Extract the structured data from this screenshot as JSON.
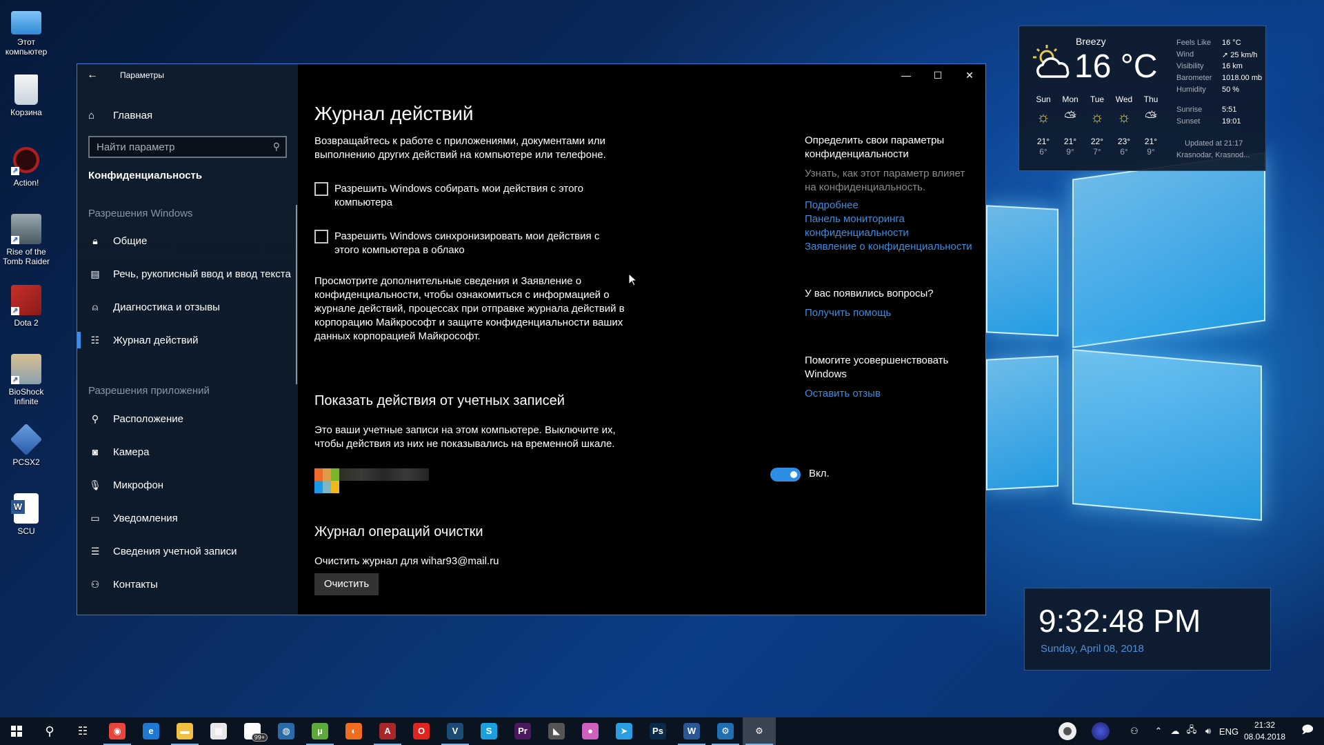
{
  "desktop": {
    "icons": [
      {
        "label": "Этот компьютер",
        "icon": "computer-icon"
      },
      {
        "label": "Корзина",
        "icon": "recycle-bin-icon"
      },
      {
        "label": "Action!",
        "icon": "action-app-icon"
      },
      {
        "label": "Rise of the Tomb Raider",
        "icon": "tomb-raider-icon"
      },
      {
        "label": "Dota 2",
        "icon": "dota2-icon"
      },
      {
        "label": "BioShock Infinite",
        "icon": "bioshock-icon"
      },
      {
        "label": "PCSX2",
        "icon": "pcsx2-icon"
      },
      {
        "label": "SCU",
        "icon": "word-document-icon"
      }
    ]
  },
  "window": {
    "title": "Параметры",
    "controls": {
      "minimize": "—",
      "maximize": "☐",
      "close": "✕"
    }
  },
  "sidebar": {
    "home_label": "Главная",
    "search_placeholder": "Найти параметр",
    "section_title": "Конфиденциальность",
    "category_windows": "Разрешения Windows",
    "category_apps": "Разрешения приложений",
    "windows_items": [
      {
        "label": "Общие",
        "icon": "lock-icon"
      },
      {
        "label": "Речь, рукописный ввод и ввод текста",
        "icon": "clipboard-icon"
      },
      {
        "label": "Диагностика и отзывы",
        "icon": "feedback-icon"
      },
      {
        "label": "Журнал действий",
        "icon": "timeline-icon",
        "active": true
      }
    ],
    "app_items": [
      {
        "label": "Расположение",
        "icon": "location-icon"
      },
      {
        "label": "Камера",
        "icon": "camera-icon"
      },
      {
        "label": "Микрофон",
        "icon": "microphone-icon"
      },
      {
        "label": "Уведомления",
        "icon": "notification-icon"
      },
      {
        "label": "Сведения учетной записи",
        "icon": "account-info-icon"
      },
      {
        "label": "Контакты",
        "icon": "contacts-icon"
      }
    ]
  },
  "main": {
    "title": "Журнал действий",
    "intro": "Возвращайтесь к работе с приложениями, документами или выполнению других действий на компьютере или телефоне.",
    "checkboxes": [
      {
        "label": "Разрешить Windows собирать мои действия с этого компьютера",
        "checked": false
      },
      {
        "label": "Разрешить Windows синхронизировать мои действия с этого компьютера в облако",
        "checked": false
      }
    ],
    "privacy_text": "Просмотрите дополнительные сведения и Заявление о конфиденциальности, чтобы ознакомиться с информацией о журнале действий, процессах при отправке журнала действий в корпорацию Майкрософт и защите конфиденциальности ваших данных корпорацией Майкрософт.",
    "accounts_heading": "Показать действия от учетных записей",
    "accounts_text": "Это ваши учетные записи на этом компьютере. Выключите их, чтобы действия из них не показывались на временной шкале.",
    "account_toggle": {
      "state": "on",
      "label": "Вкл."
    },
    "clear_heading": "Журнал операций очистки",
    "clear_text": "Очистить журнал для wihar93@mail.ru",
    "clear_button": "Очистить"
  },
  "aside": {
    "privacy_heading": "Определить свои параметры конфиденциальности",
    "privacy_sub": "Узнать, как этот параметр влияет на конфиденциальность.",
    "links": [
      "Подробнее",
      "Панель мониторинга конфиденциальности",
      "Заявление о конфиденциальности"
    ],
    "questions_heading": "У вас появились вопросы?",
    "help_link": "Получить помощь",
    "improve_heading": "Помогите усовершенствовать Windows",
    "feedback_link": "Оставить отзыв"
  },
  "weather": {
    "condition": "Breezy",
    "temperature": "16 °C",
    "details": [
      {
        "label": "Feels Like",
        "value": "16 °C"
      },
      {
        "label": "Wind",
        "value": "➚ 25 km/h"
      },
      {
        "label": "Visibility",
        "value": "16 km"
      },
      {
        "label": "Barometer",
        "value": "1018.00 mb"
      },
      {
        "label": "Humidity",
        "value": "50 %"
      }
    ],
    "sunrise_label": "Sunrise",
    "sunrise": "5:51",
    "sunset_label": "Sunset",
    "sunset": "19:01",
    "updated": "Updated at 21:17",
    "location": "Krasnodar, Krasnod...",
    "forecast": [
      {
        "day": "Sun",
        "icon": "sunny",
        "hi": "21°",
        "lo": "6°"
      },
      {
        "day": "Mon",
        "icon": "partly-cloudy",
        "hi": "21°",
        "lo": "9°"
      },
      {
        "day": "Tue",
        "icon": "sunny",
        "hi": "22°",
        "lo": "7°"
      },
      {
        "day": "Wed",
        "icon": "sunny",
        "hi": "23°",
        "lo": "6°"
      },
      {
        "day": "Thu",
        "icon": "partly-cloudy",
        "hi": "21°",
        "lo": "9°"
      }
    ]
  },
  "clock_widget": {
    "time": "9:32:48 PM",
    "date": "Sunday, April 08, 2018"
  },
  "taskbar": {
    "apps": [
      {
        "name": "chrome",
        "glyph": "◉",
        "color": "#e8453c",
        "open": true
      },
      {
        "name": "edge",
        "glyph": "e",
        "color": "#1f78d1",
        "open": false
      },
      {
        "name": "file-explorer",
        "glyph": "▬",
        "color": "#f0c040",
        "open": true
      },
      {
        "name": "store",
        "glyph": "▦",
        "color": "#e8e8e8",
        "open": false
      },
      {
        "name": "mail",
        "glyph": "✉",
        "color": "#ffffff",
        "open": false,
        "badge": "99+"
      },
      {
        "name": "steam",
        "glyph": "◍",
        "color": "#2a6aa8",
        "open": false
      },
      {
        "name": "utorrent",
        "glyph": "µ",
        "color": "#5da83a",
        "open": true
      },
      {
        "name": "origin",
        "glyph": "◐",
        "color": "#f06c1f",
        "open": false
      },
      {
        "name": "action",
        "glyph": "A",
        "color": "#a8282a",
        "open": true
      },
      {
        "name": "opera",
        "glyph": "O",
        "color": "#e0241f",
        "open": false
      },
      {
        "name": "vegas",
        "glyph": "V",
        "color": "#1a4c74",
        "open": true
      },
      {
        "name": "skype",
        "glyph": "S",
        "color": "#1aa0e0",
        "open": false
      },
      {
        "name": "premiere",
        "glyph": "Pr",
        "color": "#4a1a5c",
        "open": false
      },
      {
        "name": "geforce",
        "glyph": "◣",
        "color": "#555555",
        "open": false
      },
      {
        "name": "paint3d",
        "glyph": "●",
        "color": "#d060c0",
        "open": false
      },
      {
        "name": "telegram",
        "glyph": "➤",
        "color": "#2a9ee0",
        "open": false
      },
      {
        "name": "photoshop",
        "glyph": "Ps",
        "color": "#0a2a4a",
        "open": false
      },
      {
        "name": "word",
        "glyph": "W",
        "color": "#2b5797",
        "open": true
      },
      {
        "name": "remote-app",
        "glyph": "⚙",
        "color": "#1f6fb2",
        "open": true
      },
      {
        "name": "settings",
        "glyph": "⚙",
        "color": "transparent",
        "open": true,
        "active": true
      }
    ],
    "tray": {
      "language": "ENG",
      "time": "21:32",
      "date": "08.04.2018"
    }
  }
}
